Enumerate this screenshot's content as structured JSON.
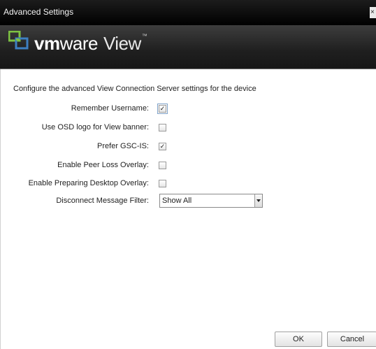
{
  "window": {
    "title": "Advanced Settings",
    "close_label": "×"
  },
  "banner": {
    "brand_vm": "vm",
    "brand_ware": "ware",
    "product": "View",
    "tm": "™"
  },
  "intro": "Configure the advanced View Connection Server settings for the device",
  "settings": [
    {
      "label": "Remember Username:",
      "checked": true,
      "check_glyph": "✓"
    },
    {
      "label": "Use OSD logo for View banner:",
      "checked": false,
      "check_glyph": ""
    },
    {
      "label": "Prefer GSC-IS:",
      "checked": true,
      "check_glyph": "✓"
    },
    {
      "label": "Enable Peer Loss Overlay:",
      "checked": false,
      "check_glyph": ""
    },
    {
      "label": "Enable Preparing Desktop Overlay:",
      "checked": false,
      "check_glyph": ""
    }
  ],
  "disconnect_filter": {
    "label": "Disconnect Message Filter:",
    "selected": "Show All"
  },
  "buttons": {
    "ok": "OK",
    "cancel": "Cancel"
  },
  "colors": {
    "logo_green": "#7dc242",
    "logo_blue": "#3d7fc1",
    "banner_bg": "#1f1f1f"
  }
}
